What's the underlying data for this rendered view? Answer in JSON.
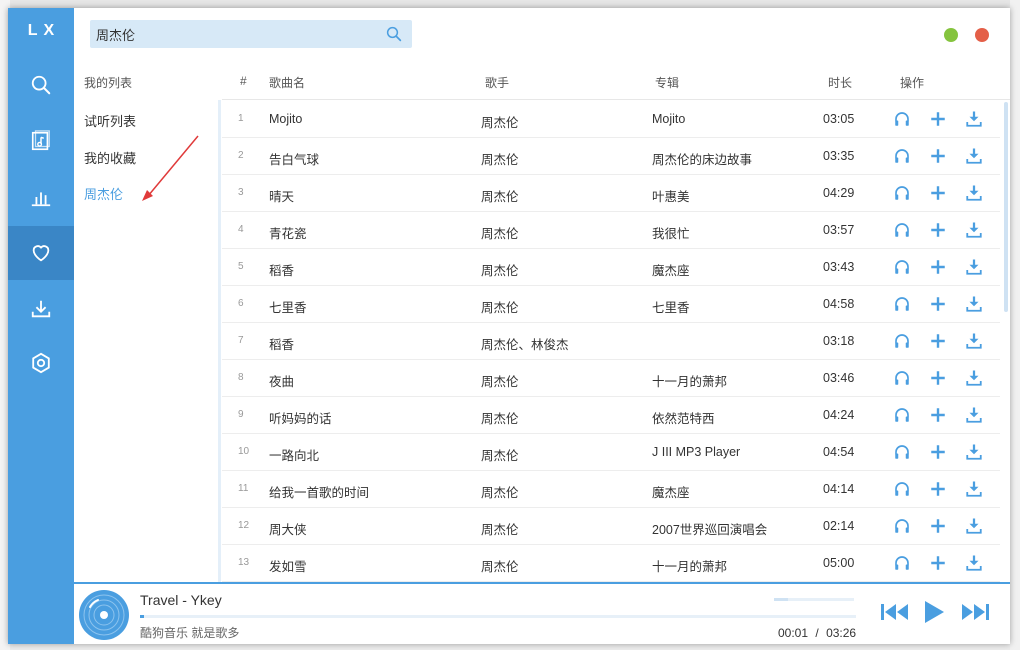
{
  "app": {
    "logo": "LX"
  },
  "rail": {
    "items": [
      {
        "name": "search",
        "icon": "search-icon",
        "active": false
      },
      {
        "name": "songlist",
        "icon": "music-list-icon",
        "active": false
      },
      {
        "name": "leaderboard",
        "icon": "bar-chart-icon",
        "active": false
      },
      {
        "name": "my-list",
        "icon": "heart-icon",
        "active": true
      },
      {
        "name": "download",
        "icon": "download-icon",
        "active": false
      },
      {
        "name": "settings",
        "icon": "hexagon-settings-icon",
        "active": false
      }
    ]
  },
  "search": {
    "value": "周杰伦",
    "icon": "search-icon"
  },
  "window_controls": {
    "min_color": "#85c43e",
    "close_color": "#e45f48"
  },
  "sidebar": {
    "title": "我的列表",
    "items": [
      {
        "label": "试听列表",
        "active": false
      },
      {
        "label": "我的收藏",
        "active": false
      },
      {
        "label": "周杰伦",
        "active": true
      }
    ]
  },
  "table": {
    "headers": {
      "num": "#",
      "song": "歌曲名",
      "singer": "歌手",
      "album": "专辑",
      "duration": "时长",
      "ops": "操作"
    },
    "rows": [
      {
        "num": "1",
        "song": "Mojito",
        "singer": "周杰伦",
        "album": "Mojito",
        "duration": "03:05"
      },
      {
        "num": "2",
        "song": "告白气球",
        "singer": "周杰伦",
        "album": "周杰伦的床边故事",
        "duration": "03:35"
      },
      {
        "num": "3",
        "song": "晴天",
        "singer": "周杰伦",
        "album": "叶惠美",
        "duration": "04:29"
      },
      {
        "num": "4",
        "song": "青花瓷",
        "singer": "周杰伦",
        "album": "我很忙",
        "duration": "03:57"
      },
      {
        "num": "5",
        "song": "稻香",
        "singer": "周杰伦",
        "album": "魔杰座",
        "duration": "03:43"
      },
      {
        "num": "6",
        "song": "七里香",
        "singer": "周杰伦",
        "album": "七里香",
        "duration": "04:58"
      },
      {
        "num": "7",
        "song": "稻香",
        "singer": "周杰伦、林俊杰",
        "album": "",
        "duration": "03:18"
      },
      {
        "num": "8",
        "song": "夜曲",
        "singer": "周杰伦",
        "album": "十一月的萧邦",
        "duration": "03:46"
      },
      {
        "num": "9",
        "song": "听妈妈的话",
        "singer": "周杰伦",
        "album": "依然范特西",
        "duration": "04:24"
      },
      {
        "num": "10",
        "song": "一路向北",
        "singer": "周杰伦",
        "album": "J III MP3 Player",
        "duration": "04:54"
      },
      {
        "num": "11",
        "song": "给我一首歌的时间",
        "singer": "周杰伦",
        "album": "魔杰座",
        "duration": "04:14"
      },
      {
        "num": "12",
        "song": "周大侠",
        "singer": "周杰伦",
        "album": "2007世界巡回演唱会",
        "duration": "02:14"
      },
      {
        "num": "13",
        "song": "发如雪",
        "singer": "周杰伦",
        "album": "十一月的萧邦",
        "duration": "05:00"
      }
    ],
    "row_actions": [
      "headphones-icon",
      "add-icon",
      "download-icon"
    ]
  },
  "player": {
    "title": "Travel - Ykey",
    "tip": "酷狗音乐 就是歌多",
    "current_time": "00:01",
    "separator": "/",
    "total_time": "03:26",
    "progress": 0.005,
    "volume": 0.18,
    "controls": [
      "prev-icon",
      "play-icon",
      "next-icon"
    ]
  },
  "colors": {
    "accent": "#4a9ee0",
    "accent_dark": "#3a86c6",
    "search_bg": "#d7e9f7",
    "annotation_arrow": "#e03a3a"
  }
}
